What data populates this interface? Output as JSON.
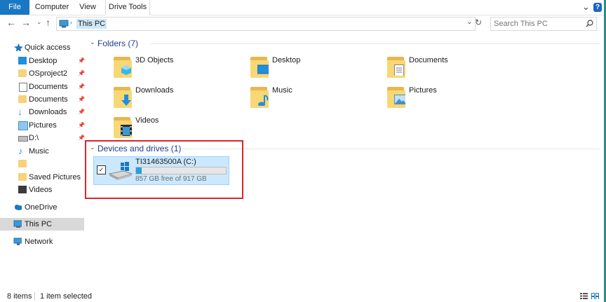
{
  "ribbon": {
    "tabs": [
      {
        "label": "File"
      },
      {
        "label": "Computer"
      },
      {
        "label": "View"
      },
      {
        "label": "Drive Tools"
      }
    ]
  },
  "address": {
    "path": "This PC",
    "search_placeholder": "Search This PC"
  },
  "nav": {
    "quick_access": "Quick access",
    "items": [
      {
        "label": "Desktop",
        "pinned": true
      },
      {
        "label": "OSproject2",
        "pinned": true
      },
      {
        "label": "Documents",
        "pinned": true
      },
      {
        "label": "Documents",
        "pinned": true
      },
      {
        "label": "Downloads",
        "pinned": true
      },
      {
        "label": "Pictures",
        "pinned": true
      },
      {
        "label": "D:\\",
        "pinned": true
      },
      {
        "label": "Music",
        "pinned": false
      },
      {
        "label": "",
        "pinned": false
      },
      {
        "label": "Saved Pictures",
        "pinned": false
      },
      {
        "label": "Videos",
        "pinned": false
      }
    ],
    "onedrive": "OneDrive",
    "this_pc": "This PC",
    "network": "Network"
  },
  "content": {
    "folders_header": "Folders (7)",
    "folders": [
      {
        "name": "3D Objects",
        "icon": "3d-objects-icon"
      },
      {
        "name": "Desktop",
        "icon": "desktop-icon"
      },
      {
        "name": "Documents",
        "icon": "documents-icon"
      },
      {
        "name": "Downloads",
        "icon": "downloads-icon"
      },
      {
        "name": "Music",
        "icon": "music-icon"
      },
      {
        "name": "Pictures",
        "icon": "pictures-icon"
      },
      {
        "name": "Videos",
        "icon": "videos-icon"
      }
    ],
    "devices_header": "Devices and drives (1)",
    "drive": {
      "name": "TI31463500A (C:)",
      "free_text": "857 GB free of 917 GB",
      "used_fraction": 0.065
    }
  },
  "status": {
    "item_count": "8 items",
    "selected": "1 item selected"
  },
  "colors": {
    "accent": "#1a78c2",
    "highlight": "#d9262c",
    "selection": "#cce8ff"
  }
}
